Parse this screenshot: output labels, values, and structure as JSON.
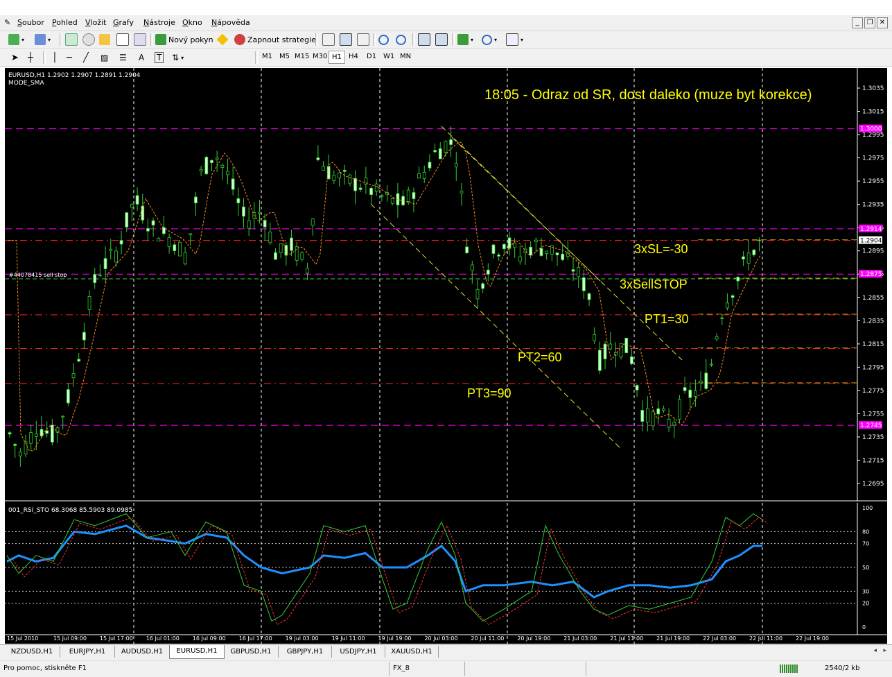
{
  "menu": [
    "Soubor",
    "Pohled",
    "Vložit",
    "Grafy",
    "Nástroje",
    "Okno",
    "Nápověda"
  ],
  "toolbar": {
    "new_order_label": "Nový pokyn",
    "strategies_label": "Zapnout strategie"
  },
  "timeframes": [
    "M1",
    "M5",
    "M15",
    "M30",
    "H1",
    "H4",
    "D1",
    "W1",
    "MN"
  ],
  "active_timeframe": "H1",
  "chart": {
    "header": "EURUSD,H1  1.2902 1.2907 1.2891 1.2904",
    "indicator_name": "MODE_SMA",
    "annotation": "18:05 - Odraz od SR, dost daleko (muze byt korekce)",
    "order_label": "#44078415 sell stop",
    "labels": {
      "sl": "3xSL=-30",
      "sellstop": "3xSellSTOP",
      "pt1": "PT1=30",
      "pt2": "PT2=60",
      "pt3": "PT3=90"
    },
    "price_ticks": [
      "1.3035",
      "1.3015",
      "1.2995",
      "1.2975",
      "1.2955",
      "1.2935",
      "1.2915",
      "1.2895",
      "1.2875",
      "1.2855",
      "1.2835",
      "1.2815",
      "1.2795",
      "1.2775",
      "1.2755",
      "1.2735",
      "1.2715",
      "1.2695"
    ],
    "price_flags": [
      {
        "text": "1.3000",
        "color": "#ff00ff"
      },
      {
        "text": "1.2914",
        "color": "#ff00ff"
      },
      {
        "text": "1.2904",
        "color": "#ffffff"
      },
      {
        "text": "1.2875",
        "color": "#ff00ff"
      },
      {
        "text": "1.2745",
        "color": "#ff00ff"
      }
    ],
    "time_labels": [
      "15 Jul 2010",
      "15 Jul 09:00",
      "15 Jul 17:00",
      "16 Jul 01:00",
      "16 Jul 09:00",
      "16 Jul 17:00",
      "19 Jul 03:00",
      "19 Jul 11:00",
      "19 Jul 19:00",
      "20 Jul 03:00",
      "20 Jul 11:00",
      "20 Jul 19:00",
      "21 Jul 03:00",
      "21 Jul 11:00",
      "21 Jul 19:00",
      "22 Jul 03:00",
      "22 Jul 11:00",
      "22 Jul 19:00"
    ]
  },
  "subwindow": {
    "header": "001_RSI_STO 68.3068 85.5903 89.0985",
    "levels": [
      "100",
      "80",
      "70",
      "50",
      "30",
      "20",
      "0"
    ]
  },
  "tabs": [
    "NZDUSD,H1",
    "EURJPY,H1",
    "AUDUSD,H1",
    "EURUSD,H1",
    "GBPUSD,H1",
    "GBPJPY,H1",
    "USDJPY,H1",
    "XAUUSD,H1"
  ],
  "active_tab": "EURUSD,H1",
  "status": {
    "help": "Pro pomoc, stiskněte F1",
    "profile": "FX_8",
    "traffic": "2540/2 kb"
  },
  "colors": {
    "magenta": "#ff00ff",
    "red_dash": "#ff2020",
    "yellow_text": "#ffff00",
    "candle_up": "#32cd32",
    "candle_body": "#ccffcc",
    "rsi_blue": "#1e90ff"
  }
}
